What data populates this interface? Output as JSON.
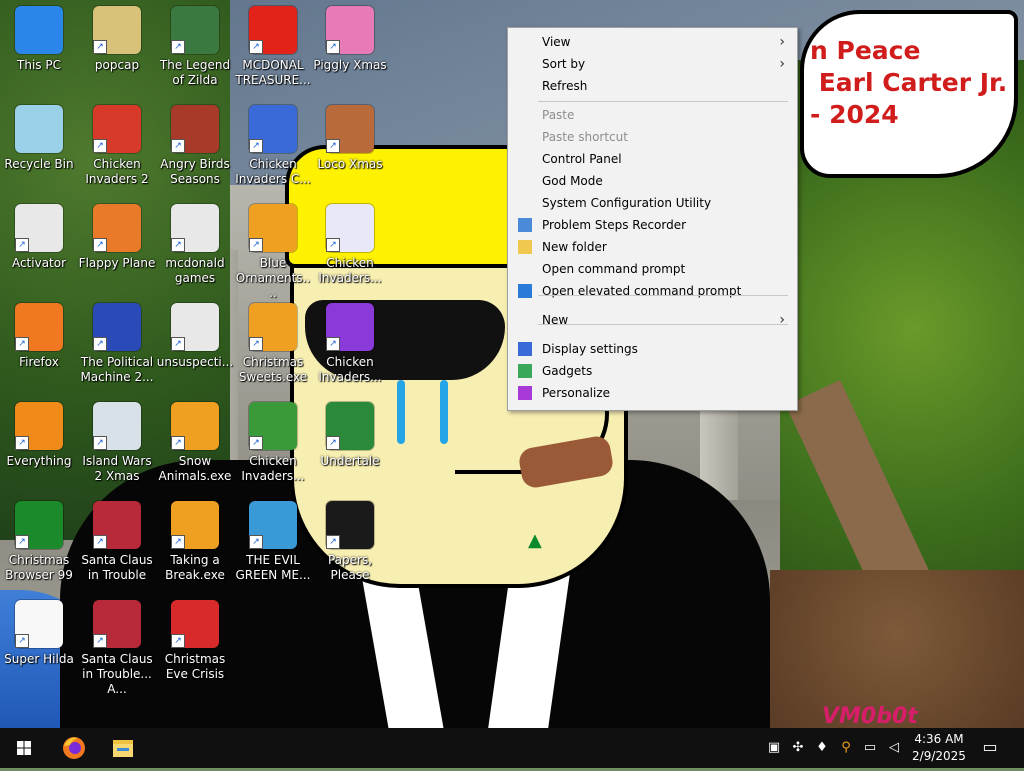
{
  "wallpaper": {
    "sign_text": "n Peace\n Earl Carter Jr.\n- 2024",
    "signature": "VM0b0t"
  },
  "desktop_icons": [
    {
      "label": "This PC",
      "icon": "computer-icon",
      "color": "#2a86e8"
    },
    {
      "label": "popcap",
      "icon": "folder-icon",
      "color": "#d8c27a"
    },
    {
      "label": "The Legend of Zilda",
      "icon": "game-icon",
      "color": "#3a7a40"
    },
    {
      "label": "MCDONAL TREASURE...",
      "icon": "mcdonalds-icon",
      "color": "#e3231a"
    },
    {
      "label": "Piggly Xmas",
      "icon": "pig-icon",
      "color": "#e87ab8"
    },
    {
      "label": "Recycle Bin",
      "icon": "recycle-bin-icon",
      "color": "#9ad0e8"
    },
    {
      "label": "Chicken Invaders 2",
      "icon": "chicken-icon",
      "color": "#d83a2a"
    },
    {
      "label": "Angry Birds Seasons",
      "icon": "angry-bird-icon",
      "color": "#a83a2a"
    },
    {
      "label": "Chicken Invaders C...",
      "icon": "chicken-icon",
      "color": "#3a6ad8"
    },
    {
      "label": "Loco Xmas",
      "icon": "teddy-icon",
      "color": "#b86a3a"
    },
    {
      "label": "Activator",
      "icon": "folder-icon",
      "color": "#e8e8e8"
    },
    {
      "label": "Flappy Plane",
      "icon": "plane-icon",
      "color": "#e87a2a"
    },
    {
      "label": "mcdonald games",
      "icon": "folder-icon",
      "color": "#e8e8e8"
    },
    {
      "label": "Blue Ornaments....",
      "icon": "puzzle-icon",
      "color": "#f0a020"
    },
    {
      "label": "Chicken Invaders...",
      "icon": "chicken-icon",
      "color": "#e8e8f8"
    },
    {
      "label": "Firefox",
      "icon": "firefox-icon",
      "color": "#f07820"
    },
    {
      "label": "The Political Machine 2...",
      "icon": "politics-icon",
      "color": "#2a4ab8"
    },
    {
      "label": "unsuspecti...",
      "icon": "folder-icon",
      "color": "#e8e8e8"
    },
    {
      "label": "Christmas Sweets.exe",
      "icon": "puzzle-icon",
      "color": "#f0a020"
    },
    {
      "label": "Chicken Invaders...",
      "icon": "chicken-icon",
      "color": "#8a3ad8"
    },
    {
      "label": "Everything",
      "icon": "search-icon",
      "color": "#f08a18"
    },
    {
      "label": "Island Wars 2 Xmas",
      "icon": "island-icon",
      "color": "#d8e0e8"
    },
    {
      "label": "Snow Animals.exe",
      "icon": "puzzle-icon",
      "color": "#f0a020"
    },
    {
      "label": "Chicken Invaders...",
      "icon": "chicken-icon",
      "color": "#3a9a3a"
    },
    {
      "label": "Undertale",
      "icon": "undertale-icon",
      "color": "#2a8a3a"
    },
    {
      "label": "Christmas Browser 99",
      "icon": "tree-icon",
      "color": "#1a8a2a"
    },
    {
      "label": "Santa Claus in Trouble",
      "icon": "santa-icon",
      "color": "#b82a3a"
    },
    {
      "label": "Taking a Break.exe",
      "icon": "puzzle-icon",
      "color": "#f0a020"
    },
    {
      "label": "THE EVIL GREEN ME...",
      "icon": "messenger-icon",
      "color": "#3a9ad8"
    },
    {
      "label": "Papers, Please",
      "icon": "papers-please-icon",
      "color": "#1a1a1a"
    },
    {
      "label": "Super Hilda",
      "icon": "dog-icon",
      "color": "#f8f8f8"
    },
    {
      "label": "Santa Claus in Trouble... A...",
      "icon": "santa-icon",
      "color": "#b82a3a"
    },
    {
      "label": "Christmas Eve Crisis",
      "icon": "santa-icon",
      "color": "#d82a2a"
    }
  ],
  "context_menu": {
    "items": [
      {
        "label": "View",
        "submenu": true,
        "disabled": false
      },
      {
        "label": "Sort by",
        "submenu": true,
        "disabled": false
      },
      {
        "label": "Refresh",
        "submenu": false,
        "disabled": false
      },
      {
        "label": "Paste",
        "submenu": false,
        "disabled": true
      },
      {
        "label": "Paste shortcut",
        "submenu": false,
        "disabled": true
      },
      {
        "label": "Control Panel",
        "submenu": false,
        "disabled": false
      },
      {
        "label": "God Mode",
        "submenu": false,
        "disabled": false
      },
      {
        "label": "System Configuration Utility",
        "submenu": false,
        "disabled": false
      },
      {
        "label": "Problem Steps Recorder",
        "submenu": false,
        "disabled": false,
        "icon": "recorder-icon"
      },
      {
        "label": "New folder",
        "submenu": false,
        "disabled": false,
        "icon": "folder-icon"
      },
      {
        "label": "Open command prompt",
        "submenu": false,
        "disabled": false
      },
      {
        "label": "Open elevated command prompt",
        "submenu": false,
        "disabled": false,
        "icon": "windows-shield-icon"
      },
      {
        "label": "New",
        "submenu": true,
        "disabled": false
      },
      {
        "label": "Display settings",
        "submenu": false,
        "disabled": false,
        "icon": "display-icon"
      },
      {
        "label": "Gadgets",
        "submenu": false,
        "disabled": false,
        "icon": "gadgets-icon"
      },
      {
        "label": "Personalize",
        "submenu": false,
        "disabled": false,
        "icon": "personalize-icon"
      }
    ]
  },
  "taskbar": {
    "start_icon": "windows-logo-icon",
    "pinned": [
      {
        "name": "firefox",
        "icon": "firefox-icon"
      },
      {
        "name": "file-explorer",
        "icon": "folder-icon"
      }
    ],
    "tray_icons": [
      "antivirus-icon",
      "bluetooth-icon",
      "water-drop-icon",
      "key-icon",
      "network-icon",
      "volume-muted-icon"
    ],
    "clock_time": "4:36 AM",
    "clock_date": "2/9/2025",
    "notification_icon": "notification-icon",
    "background": "#101010"
  }
}
